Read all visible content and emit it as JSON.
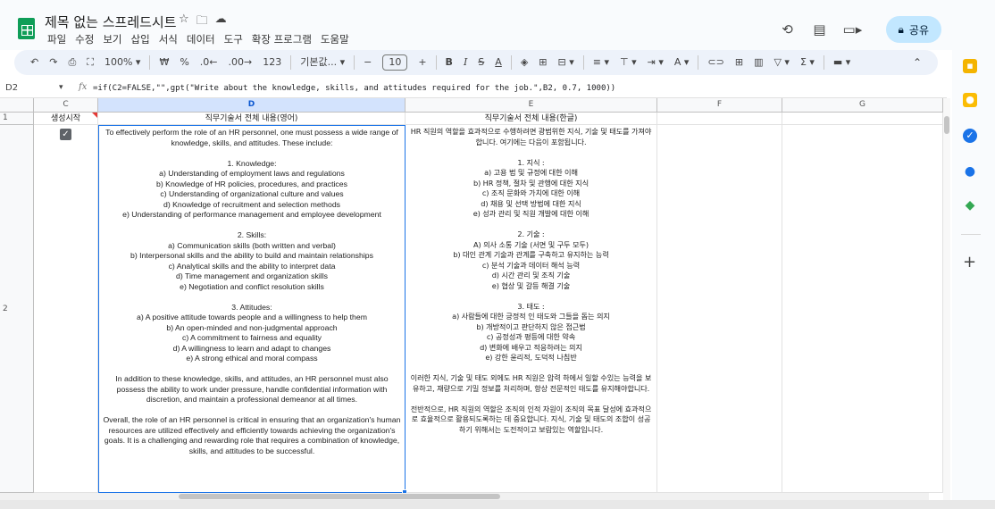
{
  "title": "제목 없는 스프레드시트",
  "menu": [
    "파일",
    "수정",
    "보기",
    "삽입",
    "서식",
    "데이터",
    "도구",
    "확장 프로그램",
    "도움말"
  ],
  "share_label": "공유",
  "toolbar": {
    "zoom": "100%",
    "currency": "₩",
    "percent": "%",
    "dec_decrease": ".0←",
    "dec_increase": ".00→",
    "number_format": "123",
    "font": "기본값...",
    "minus": "−",
    "font_size": "10",
    "plus": "+",
    "bold": "B",
    "italic": "I",
    "strike": "S",
    "text_color": "A"
  },
  "name_box": "D2",
  "formula": "=if(C2=FALSE,\"\",gpt(\"Write about the knowledge, skills, and attitudes required for the job.\",B2, 0.7, 1000))",
  "columns": [
    "C",
    "D",
    "E",
    "F",
    "G"
  ],
  "rows": [
    "1",
    "2"
  ],
  "headers": {
    "c": "생성시작",
    "d": "직무기술서 전체 내용(영어)",
    "e": "직무기술서 전체 내용(한글)"
  },
  "checkbox_checked": true,
  "cell_d2": "To effectively perform the role of an HR personnel, one must possess a wide range of knowledge, skills, and attitudes. These include:\n\n1. Knowledge:\na) Understanding of employment laws and regulations\nb) Knowledge of HR policies, procedures, and practices\nc) Understanding of organizational culture and values\nd) Knowledge of recruitment and selection methods\ne) Understanding of performance management and employee development\n\n2. Skills:\na) Communication skills (both written and verbal)\nb) Interpersonal skills and the ability to build and maintain relationships\nc) Analytical skills and the ability to interpret data\nd) Time management and organization skills\ne) Negotiation and conflict resolution skills\n\n3. Attitudes:\na) A positive attitude towards people and a willingness to help them\nb) An open-minded and non-judgmental approach\nc) A commitment to fairness and equality\nd) A willingness to learn and adapt to changes\ne) A strong ethical and moral compass\n\nIn addition to these knowledge, skills, and attitudes, an HR personnel must also possess the ability to work under pressure, handle confidential information with discretion, and maintain a professional demeanor at all times.\n\nOverall, the role of an HR personnel is critical in ensuring that an organization's human resources are utilized effectively and efficiently towards achieving the organization's goals. It is a challenging and rewarding role that requires a combination of knowledge, skills, and attitudes to be successful.",
  "cell_e2": "HR 직원의 역할을 효과적으로 수행하려면 광범위한 지식, 기술 및 태도를 가져야합니다. 여기에는 다음이 포함됩니다.\n\n1. 지식 :\na) 고용 법 및 규정에 대한 이해\nb) HR 정책, 절차 및 관행에 대한 지식\nc) 조직 문화와 가치에 대한 이해\nd) 채용 및 선택 방법에 대한 지식\ne) 성과 관리 및 직원 개발에 대한 이해\n\n2. 기술 :\nA) 의사 소통 기술 (서면 및 구두 모두)\nb) 대인 관계 기술과 관계를 구축하고 유지하는 능력\nc) 분석 기술과 데이터 해석 능력\nd) 시간 관리 및 조직 기술\ne) 협상 및 갈등 해결 기술\n\n3. 태도 :\na) 사람들에 대한 긍정적 인 태도와 그들을 돕는 의지\nb) 개방적이고 판단하지 않은 접근법\nc) 공정성과 평등에 대한 약속\nd) 변화에 배우고 적응하려는 의지\ne) 강한 윤리적, 도덕적 나침반\n\n이러한 지식, 기술 및 태도 외에도 HR 직원은 압력 하에서 일할 수있는 능력을 보유하고, 재량으로 기밀 정보를 처리하며, 항상 전문적인 태도를 유지해야합니다.\n\n전반적으로, HR 직원의 역할은 조직의 인적 자원이 조직의 목표 달성에 효과적으로 효율적으로 활용되도록하는 데 중요합니다. 지식, 기술 및 태도의 조합이 성공하기 위해서는 도전적이고 보람있는 역할입니다.",
  "icons": {
    "history": "history-icon",
    "comments": "comment-icon",
    "meet": "video-icon",
    "lock": "lock-icon"
  },
  "colors": {
    "accent": "#1a73e8",
    "share_bg": "#c2e7ff",
    "toolbar_bg": "#edf2fa",
    "sheets_green": "#0f9d58"
  }
}
